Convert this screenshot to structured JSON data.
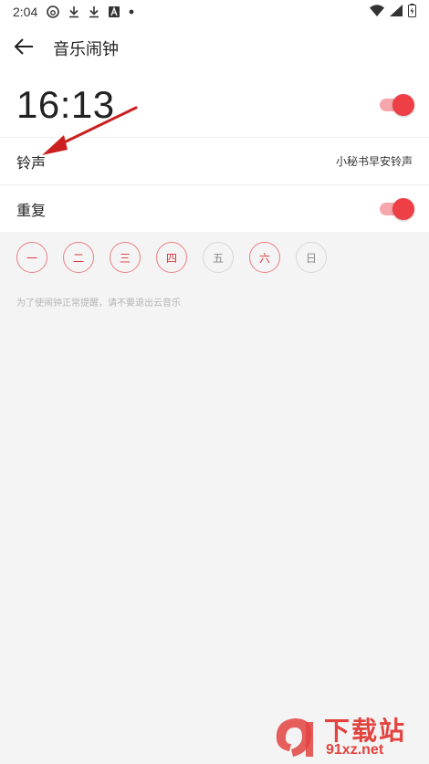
{
  "status_bar": {
    "time": "2:04",
    "icons": [
      "netease-cloud-music-icon",
      "download-icon",
      "download-icon",
      "font-a-icon",
      "dot-icon"
    ],
    "right_icons": [
      "wifi-icon",
      "cellular-signal-icon",
      "battery-icon"
    ]
  },
  "header": {
    "back_icon": "arrow-left-icon",
    "title": "音乐闹钟"
  },
  "alarm": {
    "time": "16:13",
    "enabled": true
  },
  "ringtone": {
    "label": "铃声",
    "value": "小秘书早安铃声"
  },
  "repeat": {
    "label": "重复",
    "enabled": true
  },
  "days": [
    {
      "label": "一",
      "selected": true
    },
    {
      "label": "二",
      "selected": true
    },
    {
      "label": "三",
      "selected": true
    },
    {
      "label": "四",
      "selected": true
    },
    {
      "label": "五",
      "selected": false
    },
    {
      "label": "六",
      "selected": true
    },
    {
      "label": "日",
      "selected": false
    }
  ],
  "hint": "为了使闹钟正常提醒，请不要退出云音乐",
  "watermark": {
    "brand_cn": "下载站",
    "url": "91xz.net"
  },
  "colors": {
    "accent": "#ee3e46",
    "accent_track": "#f5a7ac",
    "annotation_arrow": "#cc1f1f",
    "background": "#f4f4f4"
  }
}
